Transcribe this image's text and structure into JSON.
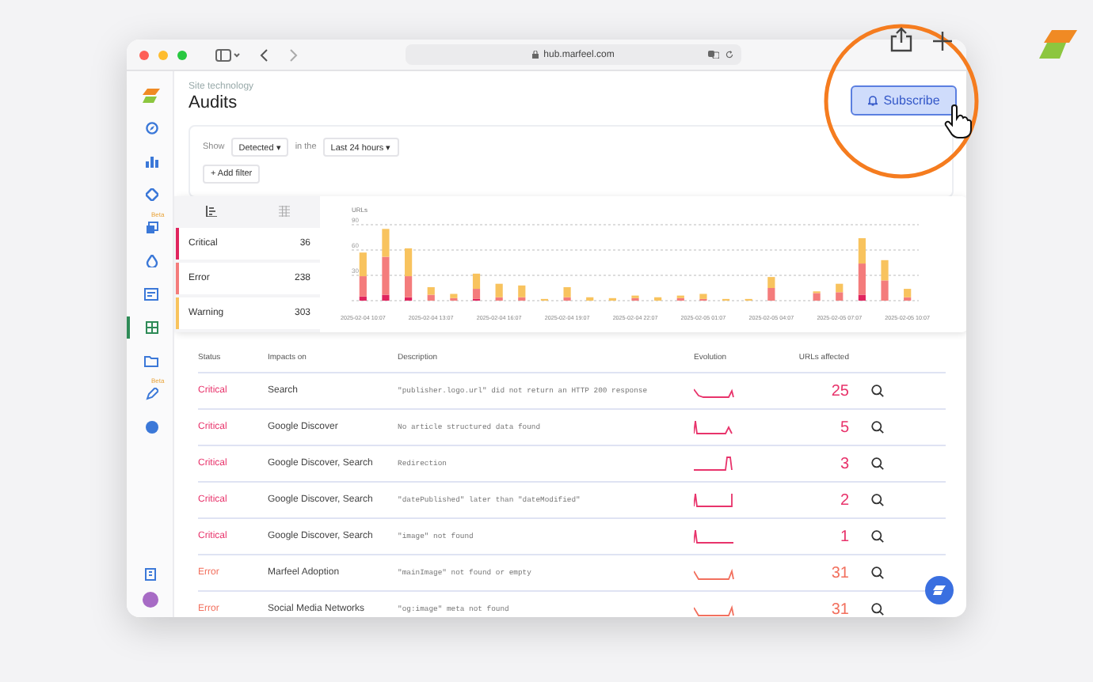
{
  "browser": {
    "url": "hub.marfeel.com"
  },
  "sidebar": {
    "items": [
      {
        "selected": false
      },
      {
        "selected": false
      },
      {
        "selected": false
      },
      {
        "selected": false
      },
      {
        "selected": false,
        "badge": "Beta"
      },
      {
        "selected": false
      },
      {
        "selected": false
      },
      {
        "selected": true
      },
      {
        "selected": false
      },
      {
        "selected": false,
        "badge": "Beta"
      },
      {
        "selected": false
      }
    ]
  },
  "header": {
    "breadcrumb": "Site technology",
    "title": "Audits",
    "subscribe": "Subscribe"
  },
  "filters": {
    "show_label": "Show",
    "show_value": "Detected",
    "period_label": "in the",
    "period_value": "Last 24 hours",
    "caret": "▾",
    "add_filter": "+ Add filter"
  },
  "summary": {
    "view_tabs": [
      {
        "selected": true
      },
      {
        "selected": false
      }
    ],
    "counts": [
      "36",
      "238",
      "303"
    ],
    "chart_data": {
      "type": "bar",
      "stacked": true,
      "ylabel": "URLs",
      "ylim": [
        0,
        90
      ],
      "yticks": [
        30,
        60,
        90
      ],
      "categories": [
        "2025-02-04 10:07",
        null,
        null,
        "2025-02-04 13:07",
        null,
        null,
        "2025-02-04 16:07",
        null,
        null,
        "2025-02-04 19:07",
        null,
        null,
        "2025-02-04 22:07",
        null,
        null,
        "2025-02-05 01:07",
        null,
        null,
        "2025-02-05 04:07",
        null,
        null,
        "2025-02-05 07:07",
        null,
        null,
        "2025-02-05 10:07"
      ],
      "series": [
        {
          "name": "Critical",
          "color": "#e0245e",
          "values": [
            5,
            7,
            4,
            0,
            0,
            2,
            0,
            0,
            0,
            0,
            0,
            0,
            0,
            0,
            0,
            0,
            0,
            0,
            0,
            0,
            0,
            0,
            7,
            0,
            0
          ]
        },
        {
          "name": "Error",
          "color": "#f47c7c",
          "values": [
            24,
            45,
            25,
            7,
            3,
            12,
            4,
            4,
            0,
            4,
            0,
            0,
            3,
            0,
            3,
            2,
            0,
            0,
            15,
            0,
            9,
            10,
            37,
            24,
            4
          ]
        },
        {
          "name": "Warning",
          "color": "#f8c35e",
          "values": [
            28,
            33,
            33,
            9,
            5,
            18,
            16,
            14,
            2,
            12,
            4,
            3,
            3,
            4,
            3,
            6,
            2,
            2,
            13,
            0,
            2,
            10,
            30,
            24,
            10
          ]
        }
      ]
    }
  },
  "table": {
    "columns": [
      "Status",
      "Impacts on",
      "Description",
      "Evolution",
      "URLs affected"
    ],
    "rows": [
      {
        "status": "Critical",
        "kind": "critical",
        "impacts": "Search",
        "description": "\"publisher.logo.url\" did not return an HTTP 200 response",
        "urls": "25"
      },
      {
        "status": "Critical",
        "kind": "critical",
        "impacts": "Google Discover",
        "description": "No article structured data found",
        "urls": "5"
      },
      {
        "status": "Critical",
        "kind": "critical",
        "impacts": "Google Discover, Search",
        "description": "Redirection",
        "urls": "3"
      },
      {
        "status": "Critical",
        "kind": "critical",
        "impacts": "Google Discover, Search",
        "description": "\"datePublished\" later than \"dateModified\"",
        "urls": "2"
      },
      {
        "status": "Critical",
        "kind": "critical",
        "impacts": "Google Discover, Search",
        "description": "\"image\" not found",
        "urls": "1"
      },
      {
        "status": "Error",
        "kind": "error",
        "impacts": "Marfeel Adoption",
        "description": "\"mainImage\" not found or empty",
        "urls": "31"
      },
      {
        "status": "Error",
        "kind": "error",
        "impacts": "Social Media Networks",
        "description": "\"og:image\" meta not found",
        "urls": "31"
      }
    ]
  }
}
